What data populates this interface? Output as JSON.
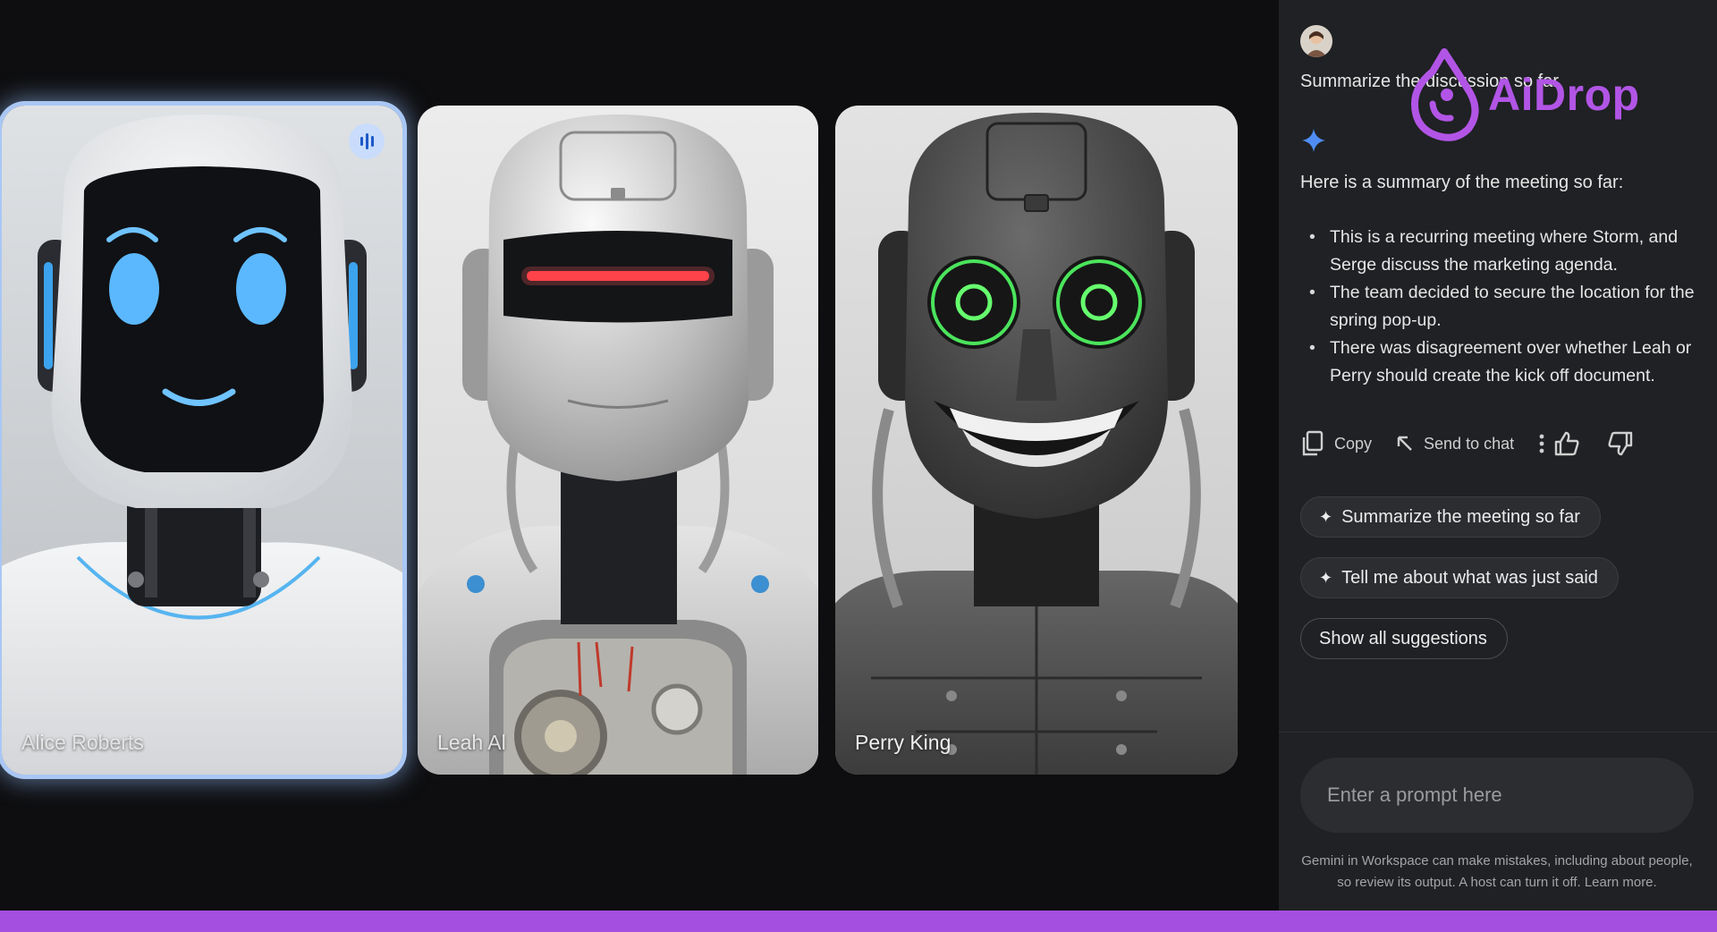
{
  "participants": [
    {
      "name": "Alice Roberts",
      "speaking": true
    },
    {
      "name": "Leah Al",
      "speaking": false
    },
    {
      "name": "Perry King",
      "speaking": false
    }
  ],
  "panel": {
    "user_prompt": "Summarize the discussion so far",
    "response": {
      "intro": "Here is a summary of the meeting so far:",
      "bullets": [
        "This is a recurring meeting where Storm, and Serge discuss the marketing agenda.",
        "The team decided to secure the location for the spring pop-up.",
        "There was disagreement over whether Leah or Perry should create the kick off document."
      ],
      "actions": {
        "copy_label": "Copy",
        "send_label": "Send to chat"
      }
    },
    "suggestions": [
      "Summarize the meeting so far",
      "Tell me about what was just said"
    ],
    "show_all_label": "Show all suggestions",
    "prompt_placeholder": "Enter a prompt here",
    "disclaimer": "Gemini in Workspace can make mistakes, including about people, so review its output. A host can turn it off. Learn more."
  },
  "watermark": {
    "text": "AiDrop",
    "color": "#b255e6"
  },
  "colors": {
    "accent_blue": "#4f8df5",
    "active_tile_glow": "#a9c7f4",
    "bottom_bar": "#a54fe0",
    "panel_bg": "#1f2124"
  },
  "icons": [
    "speaking-indicator-icon",
    "sparkle-icon",
    "copy-icon",
    "send-to-chat-icon",
    "more-vert-icon",
    "thumbs-up-icon",
    "thumbs-down-icon"
  ]
}
